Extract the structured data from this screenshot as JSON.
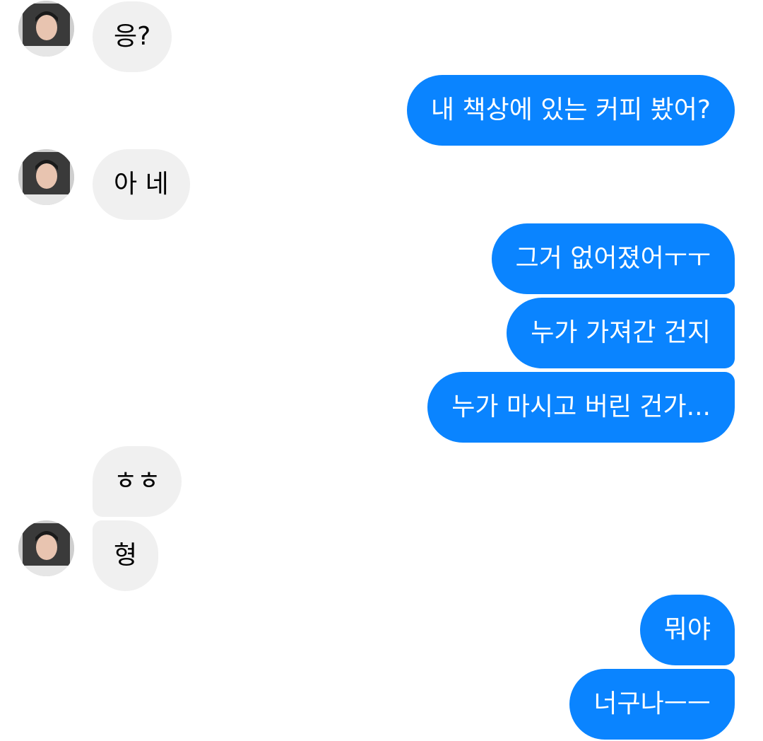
{
  "conversation": {
    "messages": [
      {
        "id": "m1",
        "sender": "other",
        "text": "응?"
      },
      {
        "id": "m2",
        "sender": "me",
        "text": "내 책상에 있는 커피 봤어?"
      },
      {
        "id": "m3",
        "sender": "other",
        "text": "아 네"
      },
      {
        "id": "m4",
        "sender": "me",
        "text": "그거 없어졌어ㅜㅜ"
      },
      {
        "id": "m5",
        "sender": "me",
        "text": "누가 가져간 건지"
      },
      {
        "id": "m6",
        "sender": "me",
        "text": "누가 마시고 버린 건가..."
      },
      {
        "id": "m7",
        "sender": "other",
        "text": "ㅎㅎ"
      },
      {
        "id": "m8",
        "sender": "other",
        "text": "형"
      },
      {
        "id": "m9",
        "sender": "me",
        "text": "뭐야"
      },
      {
        "id": "m10",
        "sender": "me",
        "text": "너구나ㅡㅡ"
      }
    ]
  },
  "colors": {
    "sent_bubble": "#0a84ff",
    "received_bubble": "#f0f0f0",
    "sent_text": "#ffffff",
    "received_text": "#000000"
  },
  "icons": {
    "avatar": "contact-photo"
  }
}
